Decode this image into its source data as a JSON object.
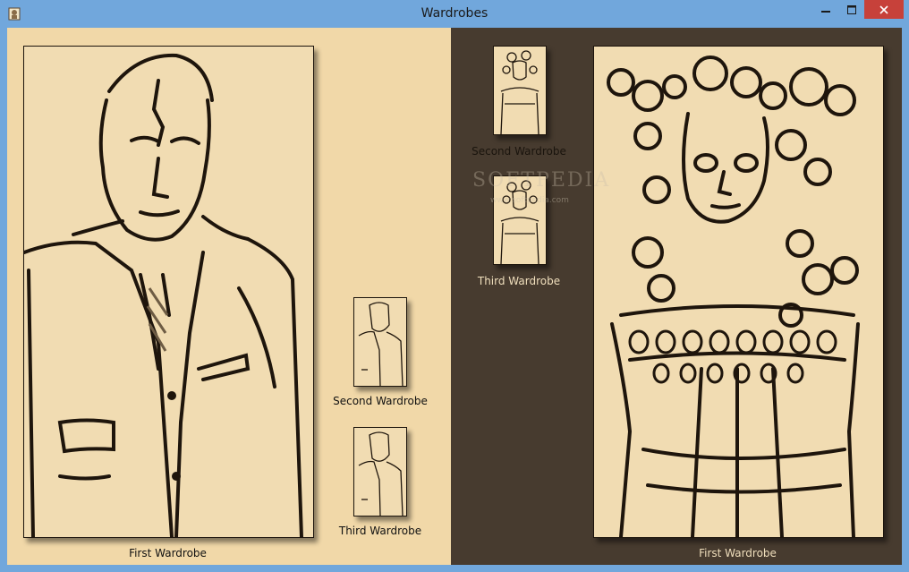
{
  "window": {
    "title": "Wardrobes",
    "icons": {
      "app": "wardrobe-app-icon",
      "minimize": "minimize-icon",
      "maximize": "maximize-icon",
      "close": "close-icon"
    },
    "colors": {
      "titlebar": "#71a7dc",
      "close": "#c7413a",
      "left_bg": "#f1d8a8",
      "right_bg": "#473b2f"
    }
  },
  "left": {
    "main_caption": "First Wardrobe",
    "thumbs": [
      {
        "caption": "Second Wardrobe"
      },
      {
        "caption": "Third Wardrobe"
      }
    ]
  },
  "right": {
    "main_caption": "First Wardrobe",
    "thumbs": [
      {
        "caption": "Second Wardrobe"
      },
      {
        "caption": "Third Wardrobe"
      }
    ]
  },
  "watermark": {
    "text": "SOFTPEDIA",
    "url": "www.softpedia.com"
  }
}
